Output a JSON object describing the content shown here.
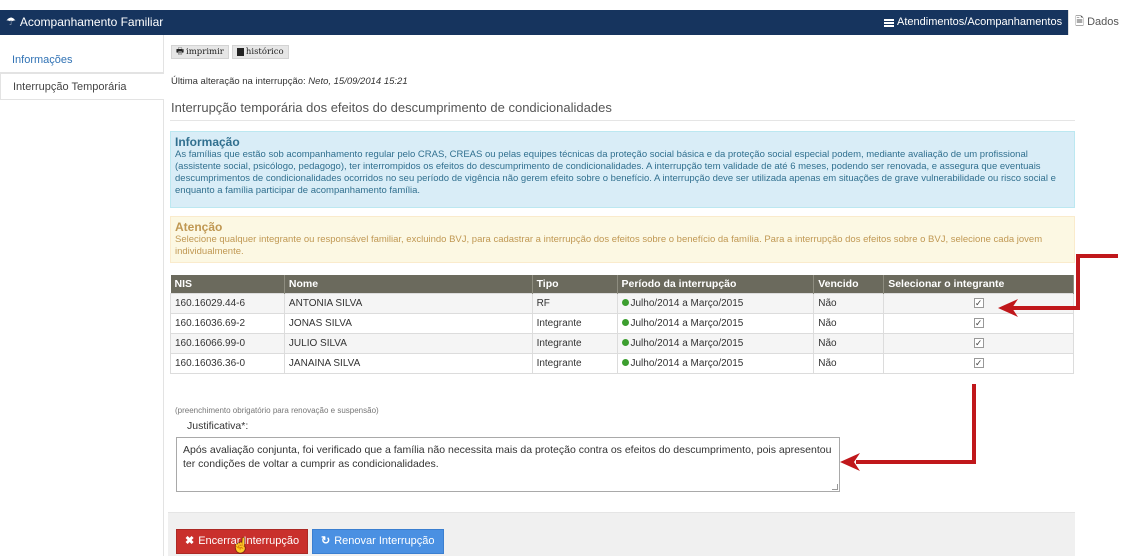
{
  "app": {
    "title": "Acompanhamento Familiar",
    "nav_atendimentos": "Atendimentos/Acompanhamentos",
    "nav_dados": "Dados"
  },
  "sidebar": {
    "items": [
      {
        "label": "Informações"
      },
      {
        "label": "Interrupção Temporária"
      }
    ]
  },
  "toolbar": {
    "print_label": "imprimir",
    "history_label": "histórico"
  },
  "last_change": {
    "label": "Última alteração na interrupção:",
    "value": "Neto, 15/09/2014 15:21"
  },
  "page_title": "Interrupção temporária dos efeitos do descumprimento de condicionalidades",
  "info_alert": {
    "title": "Informação",
    "text": "As famílias que estão sob acompanhamento regular pelo CRAS, CREAS ou pelas equipes técnicas da proteção social básica e da proteção social especial podem, mediante avaliação de um profissional (assistente social, psicólogo, pedagogo), ter interrompidos os efeitos do descumprimento de condicionalidades. A interrupção tem validade de até 6 meses, podendo ser renovada, e assegura que eventuais descumprimentos de condicionalidades ocorridos no seu período de vigência não gerem efeito sobre o benefício. A interrupção deve ser utilizada apenas em situações de grave vulnerabilidade ou risco social e enquanto a família participar de acompanhamento família."
  },
  "warn_alert": {
    "title": "Atenção",
    "text": "Selecione qualquer integrante ou responsável familiar, excluindo BVJ, para cadastrar a interrupção dos efeitos sobre o benefício da família. Para a interrupção dos efeitos sobre o BVJ, selecione cada jovem individualmente."
  },
  "table": {
    "headers": [
      "NIS",
      "Nome",
      "Tipo",
      "Período da interrupção",
      "Vencido",
      "Selecionar o integrante"
    ],
    "rows": [
      {
        "nis": "160.16029.44-6",
        "nome": "ANTONIA SILVA",
        "tipo": "RF",
        "periodo": "Julho/2014 a Março/2015",
        "vencido": "Não",
        "selected": true
      },
      {
        "nis": "160.16036.69-2",
        "nome": "JONAS SILVA",
        "tipo": "Integrante",
        "periodo": "Julho/2014 a Março/2015",
        "vencido": "Não",
        "selected": true
      },
      {
        "nis": "160.16066.99-0",
        "nome": "JULIO SILVA",
        "tipo": "Integrante",
        "periodo": "Julho/2014 a Março/2015",
        "vencido": "Não",
        "selected": true
      },
      {
        "nis": "160.16036.36-0",
        "nome": "JANAINA SILVA",
        "tipo": "Integrante",
        "periodo": "Julho/2014 a Março/2015",
        "vencido": "Não",
        "selected": true
      }
    ]
  },
  "justificativa": {
    "hint": "(preenchimento obrigatório para renovação e suspensão)",
    "label": "Justificativa*:",
    "value": "Após avaliação conjunta, foi verificado que a família não necessita mais da proteção contra os efeitos do descumprimento, pois apresentou ter condições de voltar a cumprir as condicionalidades."
  },
  "actions": {
    "end_label": "Encerrar Interrupção",
    "renew_label": "Renovar Interrupção"
  },
  "colors": {
    "topbar": "#16345e",
    "table_header": "#6b6a5d",
    "status_green": "#3c9e2f",
    "btn_red": "#c9302c",
    "btn_blue": "#4a90e2",
    "arrow": "#c0171b"
  },
  "icons": [
    "umbrella-icon",
    "menu-icon",
    "document-icon",
    "printer-icon",
    "book-icon",
    "close-icon",
    "refresh-icon",
    "hand-cursor-icon"
  ]
}
